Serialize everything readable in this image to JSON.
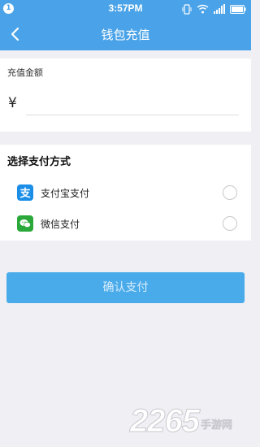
{
  "status_bar": {
    "notification_count": "1",
    "time": "3:57PM"
  },
  "nav": {
    "back_icon": "chevron-left-icon",
    "title": "钱包充值"
  },
  "amount": {
    "label": "充值金额",
    "currency_symbol": "¥",
    "value": "",
    "placeholder": ""
  },
  "payment": {
    "heading": "选择支付方式",
    "methods": [
      {
        "name": "支付宝支付",
        "icon": "alipay-icon",
        "color": "#1b8ee8",
        "selected": false
      },
      {
        "name": "微信支付",
        "icon": "wechat-icon",
        "color": "#2aa83a",
        "selected": false
      }
    ]
  },
  "confirm_label": "确认支付",
  "watermark": {
    "number": "2265",
    "text": "手游网"
  },
  "colors": {
    "primary": "#4aa3e8",
    "background": "#efeff4"
  }
}
